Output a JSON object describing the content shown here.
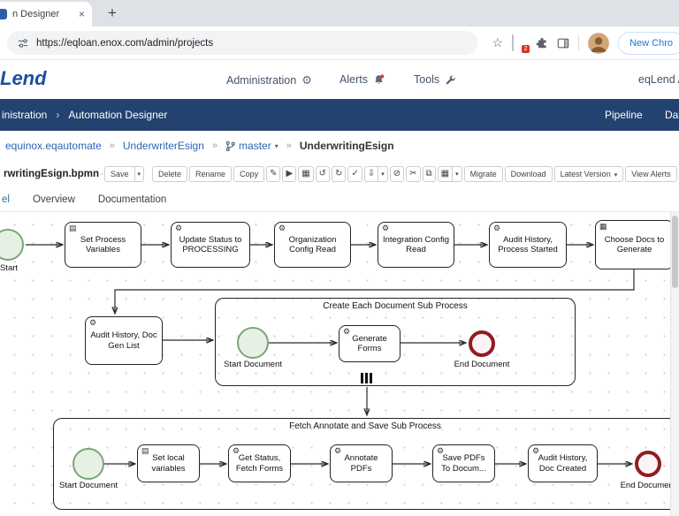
{
  "browser": {
    "tab_title": "n Designer",
    "close_tab": "×",
    "new_tab": "+",
    "url": "https://eqloan.enox.com/admin/projects",
    "star": "☆",
    "extension_badge": "2",
    "new_chrome_label": "New Chro"
  },
  "header": {
    "logo": "Lend",
    "nav": [
      {
        "label": "Administration"
      },
      {
        "label": "Alerts"
      },
      {
        "label": "Tools"
      }
    ],
    "gear_glyph": "⚙",
    "account_label": "eqLend A"
  },
  "navbar": {
    "crumb_left": "inistration",
    "crumb_sep": "›",
    "crumb_right": "Automation Designer",
    "pipeline": "Pipeline",
    "dashboard": "Da"
  },
  "breadcrumb": {
    "project": "equinox.eqautomate",
    "sep": "»",
    "workflow": "UnderwriterEsign",
    "branch": "master",
    "caret": "▾",
    "file": "UnderwritingEsign"
  },
  "toolbar": {
    "filename": "rwritingEsign.bpmn - ...",
    "save": "Save",
    "caret": "▾",
    "delete": "Delete",
    "rename": "Rename",
    "copy": "Copy",
    "icons": [
      {
        "name": "edit",
        "glyph": "✎"
      },
      {
        "name": "play",
        "glyph": "▶"
      },
      {
        "name": "grid",
        "glyph": "▦"
      },
      {
        "name": "undo",
        "glyph": "↺"
      },
      {
        "name": "redo",
        "glyph": "↻"
      },
      {
        "name": "validate",
        "glyph": "✓"
      },
      {
        "name": "download-split",
        "glyph": "⇩"
      },
      {
        "name": "disable",
        "glyph": "⊘"
      },
      {
        "name": "cut",
        "glyph": "✂"
      },
      {
        "name": "paste",
        "glyph": "⧉"
      },
      {
        "name": "table",
        "glyph": "▦"
      }
    ],
    "migrate": "Migrate",
    "download": "Download",
    "latest_version": "Latest Version",
    "view_alerts": "View Alerts",
    "close": "×"
  },
  "tabs": {
    "model": "el",
    "overview": "Overview",
    "documentation": "Documentation"
  },
  "icon_glyphs": {
    "gear": "⚙",
    "script": "▤",
    "table": "▦"
  },
  "diagram": {
    "start_label": "Start",
    "top_tasks": [
      {
        "label": "Set Process Variables",
        "icon": "script"
      },
      {
        "label": "Update Status to PROCESSING",
        "icon": "gear"
      },
      {
        "label": "Organization Config Read",
        "icon": "gear"
      },
      {
        "label": "Integration Config Read",
        "icon": "gear"
      },
      {
        "label": "Audit History, Process Started",
        "icon": "gear"
      },
      {
        "label": "Choose Docs to Generate",
        "icon": "table"
      }
    ],
    "audit_doc_gen": "Audit History, Doc Gen List",
    "subprocess1": {
      "title": "Create Each Document Sub Process",
      "start_label": "Start Document",
      "task": "Generate Forms",
      "end_label": "End Document"
    },
    "subprocess2": {
      "title": "Fetch Annotate and Save Sub Process",
      "start_label": "Start Document",
      "tasks": [
        {
          "label": "Set local variables",
          "icon": "script"
        },
        {
          "label": "Get Status, Fetch Forms",
          "icon": "gear"
        },
        {
          "label": "Annotate PDFs",
          "icon": "gear"
        },
        {
          "label": "Save PDFs To Docum...",
          "icon": "gear"
        },
        {
          "label": "Audit History, Doc Created",
          "icon": "gear"
        }
      ],
      "end_label": "End Document"
    }
  }
}
